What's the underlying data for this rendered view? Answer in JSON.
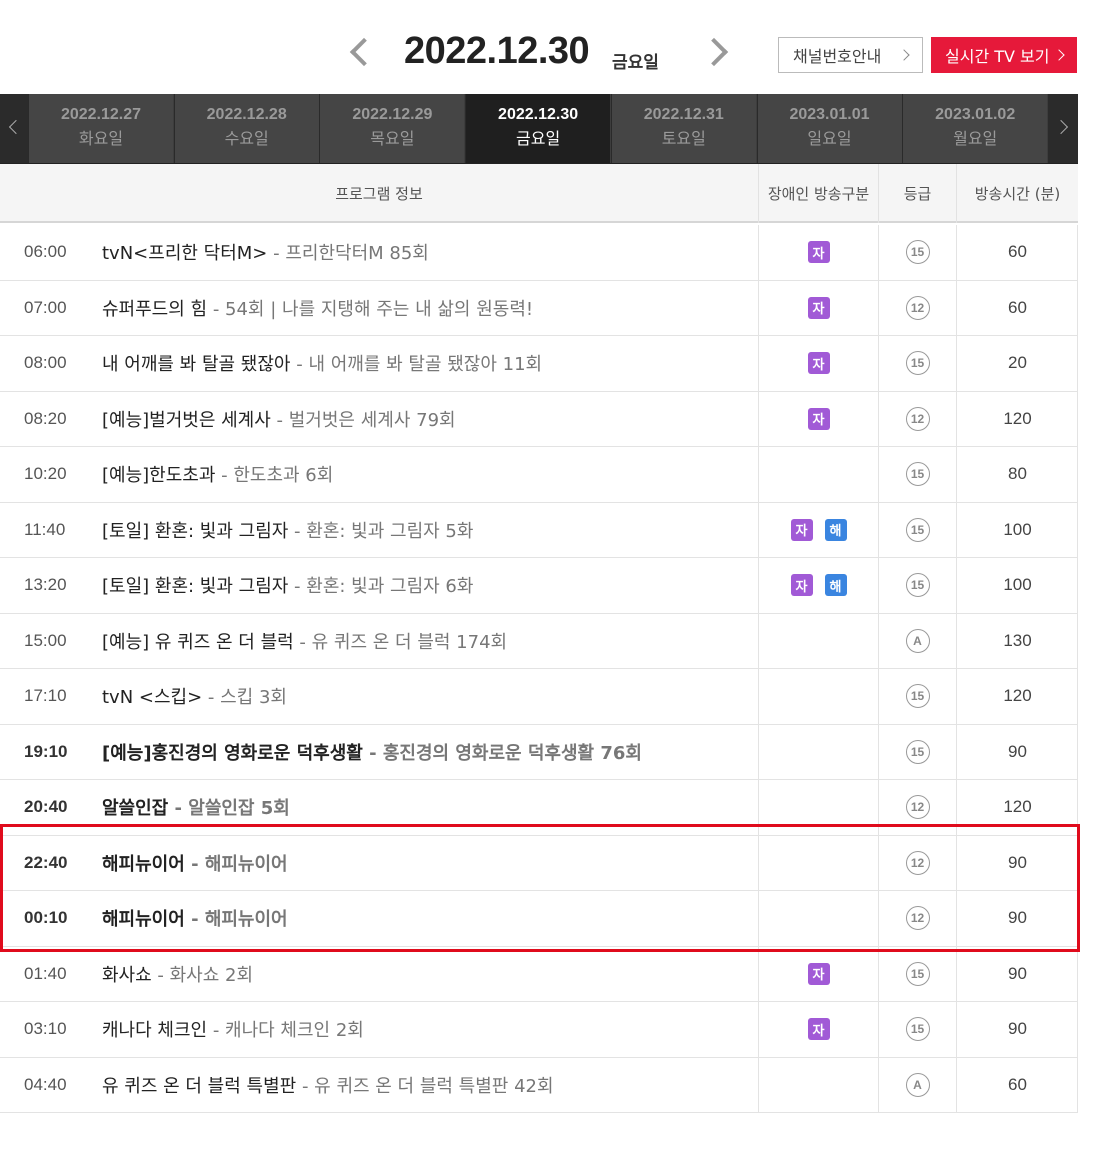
{
  "header": {
    "date": "2022.12.30",
    "weekday": "금요일",
    "channel_guide_label": "채널번호안내",
    "live_tv_label": "실시간 TV 보기",
    "colors": {
      "live_button": "#e6193a",
      "highlight": "#e00b1c"
    }
  },
  "tabs": [
    {
      "date": "2022.12.27",
      "weekday": "화요일",
      "active": false
    },
    {
      "date": "2022.12.28",
      "weekday": "수요일",
      "active": false
    },
    {
      "date": "2022.12.29",
      "weekday": "목요일",
      "active": false
    },
    {
      "date": "2022.12.30",
      "weekday": "금요일",
      "active": true
    },
    {
      "date": "2022.12.31",
      "weekday": "토요일",
      "active": false
    },
    {
      "date": "2023.01.01",
      "weekday": "일요일",
      "active": false
    },
    {
      "date": "2023.01.02",
      "weekday": "월요일",
      "active": false
    }
  ],
  "table": {
    "headers": {
      "info": "프로그램 정보",
      "accessibility": "장애인 방송구분",
      "grade": "등급",
      "duration": "방송시간 (분)"
    },
    "rows": [
      {
        "time": "06:00",
        "title": "tvN<프리한 닥터M>",
        "episode": " - 프리한닥터M 85회",
        "access": [
          "자"
        ],
        "grade": "15",
        "duration": "60",
        "bold": false
      },
      {
        "time": "07:00",
        "title": "슈퍼푸드의 힘",
        "episode": " - 54회 | 나를 지탱해 주는 내 삶의 원동력!",
        "access": [
          "자"
        ],
        "grade": "12",
        "duration": "60",
        "bold": false
      },
      {
        "time": "08:00",
        "title": "내 어깨를 봐 탈골 됐잖아",
        "episode": " - 내 어깨를 봐 탈골 됐잖아 11회",
        "access": [
          "자"
        ],
        "grade": "15",
        "duration": "20",
        "bold": false
      },
      {
        "time": "08:20",
        "title": "[예능]벌거벗은 세계사",
        "episode": " - 벌거벗은 세계사 79회",
        "access": [
          "자"
        ],
        "grade": "12",
        "duration": "120",
        "bold": false
      },
      {
        "time": "10:20",
        "title": "[예능]한도초과",
        "episode": " - 한도초과 6회",
        "access": [],
        "grade": "15",
        "duration": "80",
        "bold": false
      },
      {
        "time": "11:40",
        "title": "[토일] 환혼: 빛과 그림자",
        "episode": " - 환혼: 빛과 그림자 5화",
        "access": [
          "자",
          "해"
        ],
        "grade": "15",
        "duration": "100",
        "bold": false
      },
      {
        "time": "13:20",
        "title": "[토일] 환혼: 빛과 그림자",
        "episode": " - 환혼: 빛과 그림자 6화",
        "access": [
          "자",
          "해"
        ],
        "grade": "15",
        "duration": "100",
        "bold": false
      },
      {
        "time": "15:00",
        "title": "[예능] 유 퀴즈 온 더 블럭",
        "episode": " - 유 퀴즈 온 더 블럭 174회",
        "access": [],
        "grade": "A",
        "duration": "130",
        "bold": false
      },
      {
        "time": "17:10",
        "title": "tvN <스킵>",
        "episode": " - 스킵 3회",
        "access": [],
        "grade": "15",
        "duration": "120",
        "bold": false
      },
      {
        "time": "19:10",
        "title": "[예능]홍진경의 영화로운 덕후생활",
        "episode": " - 홍진경의 영화로운 덕후생활 76회",
        "access": [],
        "grade": "15",
        "duration": "90",
        "bold": true
      },
      {
        "time": "20:40",
        "title": "알쓸인잡",
        "episode": " - 알쓸인잡 5회",
        "access": [],
        "grade": "12",
        "duration": "120",
        "bold": true
      },
      {
        "time": "22:40",
        "title": "해피뉴이어",
        "episode": " - 해피뉴이어",
        "access": [],
        "grade": "12",
        "duration": "90",
        "bold": true
      },
      {
        "time": "00:10",
        "title": "해피뉴이어",
        "episode": " - 해피뉴이어",
        "access": [],
        "grade": "12",
        "duration": "90",
        "bold": true
      },
      {
        "time": "01:40",
        "title": "화사쇼",
        "episode": " - 화사쇼 2회",
        "access": [
          "자"
        ],
        "grade": "15",
        "duration": "90",
        "bold": false
      },
      {
        "time": "03:10",
        "title": "캐나다 체크인",
        "episode": " - 캐나다 체크인 2회",
        "access": [
          "자"
        ],
        "grade": "15",
        "duration": "90",
        "bold": false
      },
      {
        "time": "04:40",
        "title": "유 퀴즈 온 더 블럭 특별판",
        "episode": " - 유 퀴즈 온 더 블럭 특별판 42회",
        "access": [],
        "grade": "A",
        "duration": "60",
        "bold": false
      }
    ]
  }
}
